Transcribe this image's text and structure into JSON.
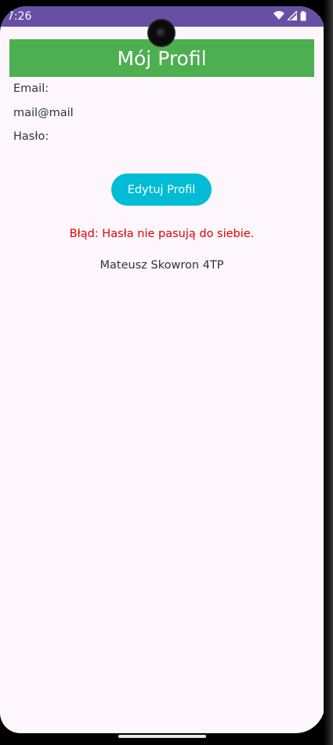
{
  "status_bar": {
    "time": "7:26",
    "icons": [
      "wifi-icon",
      "signal-icon",
      "battery-icon"
    ]
  },
  "app_bar": {
    "title": "Mój Profil",
    "color": "#4caf50"
  },
  "profile": {
    "email_label": "Email:",
    "email_value": "mail@mail",
    "password_label": "Hasło:"
  },
  "edit_button": {
    "label": "Edytuj Profil",
    "color": "#00bcd4"
  },
  "error_message": "Błąd: Hasła nie pasują do siebie.",
  "author": "Mateusz Skowron 4TP",
  "colors": {
    "status_bar": "#6750a4",
    "background": "#fdf7fd",
    "error": "#e00000"
  }
}
